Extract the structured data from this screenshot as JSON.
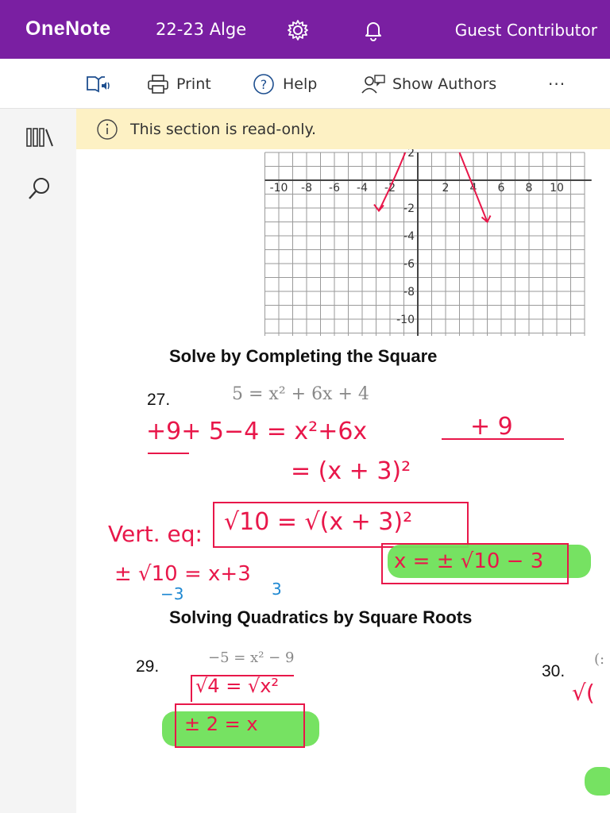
{
  "header": {
    "app_name": "OneNote",
    "notebook": "22-23 Alge",
    "user": "Guest Contributor"
  },
  "toolbar": {
    "print": "Print",
    "help": "Help",
    "show_authors": "Show Authors",
    "more": "···"
  },
  "banner": {
    "text": "This section is read-only."
  },
  "graph": {
    "x_ticks": [
      "-10",
      "-8",
      "-6",
      "-4",
      "-2",
      "2",
      "4",
      "6",
      "8",
      "10"
    ],
    "y_ticks": [
      "2",
      "-2",
      "-4",
      "-6",
      "-8",
      "-10"
    ]
  },
  "sections": {
    "completing_square": "Solve by Completing the Square",
    "square_roots": "Solving Quadratics by Square Roots"
  },
  "problems": {
    "p27_num": "27.",
    "p27_eq": "5 = x² + 6x + 4",
    "p29_num": "29.",
    "p29_eq": "−5 = x² − 9",
    "p30_num": "30.",
    "p30_eq": "(:"
  },
  "handwriting": {
    "line1_left": "+9+ 5−4 = x²+6x",
    "line1_right": "+ 9",
    "line2": "= (x + 3)²",
    "vert_label": "Vert. eq:",
    "boxed_eq": "√10 = √(x + 3)²",
    "pm_line": "± √10 = x+3",
    "minus3": "−3",
    "small3": "3",
    "answer27": "x = ± √10 − 3",
    "p29_work": "√4 = √x²",
    "answer29": "± 2 = x",
    "p30_work": "√("
  },
  "colors": {
    "header": "#7a1fa2",
    "ink_red": "#e8174a",
    "ink_blue": "#1e88d2",
    "highlight": "#6fe05a",
    "banner": "#fdf1c4"
  }
}
